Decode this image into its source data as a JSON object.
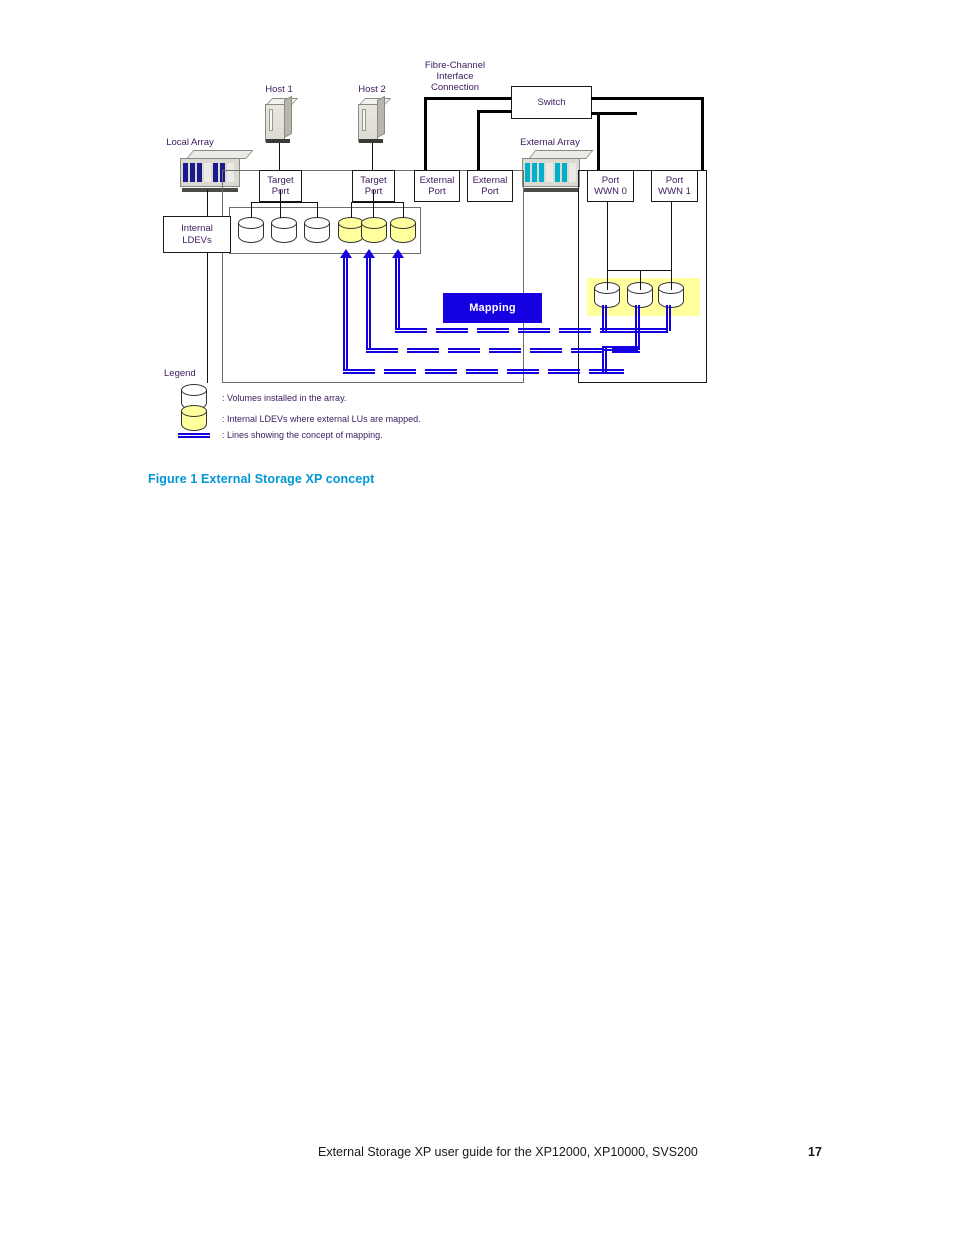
{
  "figure": {
    "caption": "Figure 1 External Storage XP concept",
    "labels": {
      "local_array": "Local Array",
      "external_array": "External Array",
      "host1": "Host 1",
      "host2": "Host 2",
      "fibre_channel": "Fibre-Channel\nInterface\nConnection",
      "switch": "Switch",
      "internal_ldevs": "Internal\nLDEVs",
      "mapping": "Mapping",
      "legend_title": "Legend"
    },
    "ports": [
      {
        "name": "target-port-1",
        "text": "Target\nPort"
      },
      {
        "name": "target-port-2",
        "text": "Target\nPort"
      },
      {
        "name": "external-port-1",
        "text": "External\nPort"
      },
      {
        "name": "external-port-2",
        "text": "External\nPort"
      },
      {
        "name": "port-wwn-0",
        "text": "Port\nWWN 0"
      },
      {
        "name": "port-wwn-1",
        "text": "Port\nWWN 1"
      }
    ],
    "legend": [
      {
        "icon": "white-cylinder",
        "text": ": Volumes installed in the array."
      },
      {
        "icon": "yellow-cylinder",
        "text": ": Internal LDEVs where external LUs are mapped."
      },
      {
        "icon": "blue-double-line",
        "text": ": Lines showing the concept of mapping."
      }
    ],
    "volumes": {
      "internal_white_count": 3,
      "internal_mapped_count": 3,
      "external_count": 3
    },
    "colors": {
      "caption": "#0096d6",
      "label_text": "#3b1a5e",
      "mapping_banner": "#1400e0",
      "mapping_banner_text": "#ffffff",
      "mapped_volume_fill": "#ffff9e",
      "local_array_bars": "#1a1a8c",
      "external_array_bars": "#00b0c8",
      "frame_line": "#6e6e6e"
    }
  },
  "footer": {
    "text": "External Storage XP user guide for the XP12000, XP10000, SVS200",
    "page_number": "17"
  }
}
